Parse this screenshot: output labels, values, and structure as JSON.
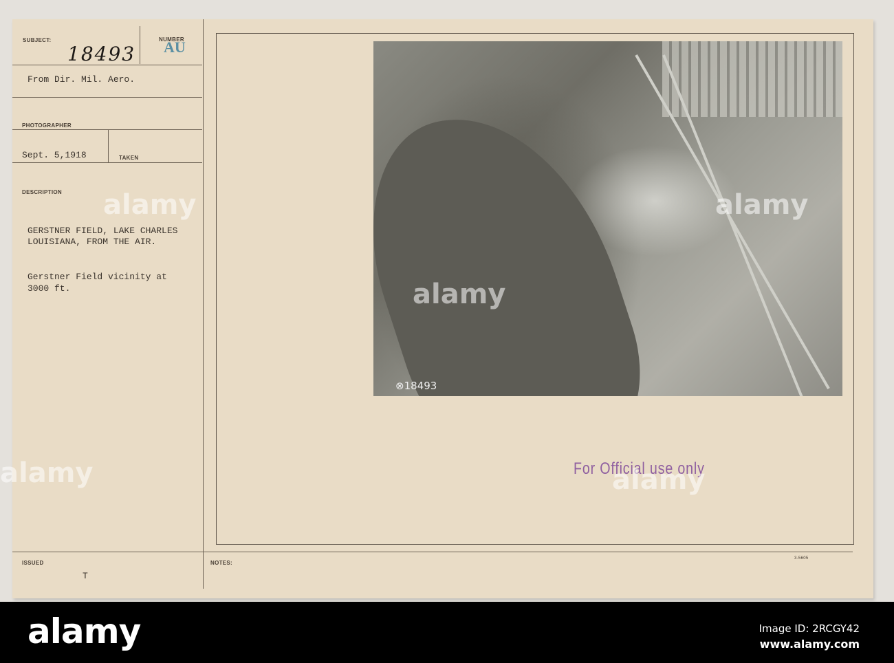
{
  "card": {
    "subject_label": "SUBJECT:",
    "subject_number": "18493",
    "number_label": "NUMBER",
    "number_stamp": "AU",
    "from": "From Dir. Mil. Aero.",
    "photographer_label": "PHOTOGRAPHER",
    "date": "Sept. 5,1918",
    "taken_label": "TAKEN",
    "description_label": "DESCRIPTION",
    "description_lines": [
      "GERSTNER FIELD, LAKE CHARLES",
      "LOUISIANA, FROM THE AIR."
    ],
    "caption_lines": [
      "Gerstner Field vicinity at",
      "3000 ft."
    ],
    "issued_label": "ISSUED",
    "issued_mark": "T",
    "notes_label": "NOTES:",
    "form_code": "3-5605",
    "photo_number": "⊗18493",
    "official_stamp": "For Official use only"
  },
  "watermark": {
    "text": "alamy"
  },
  "footer": {
    "logo": "alamy",
    "image_id": "Image ID: 2RCGY42",
    "site": "www.alamy.com"
  }
}
